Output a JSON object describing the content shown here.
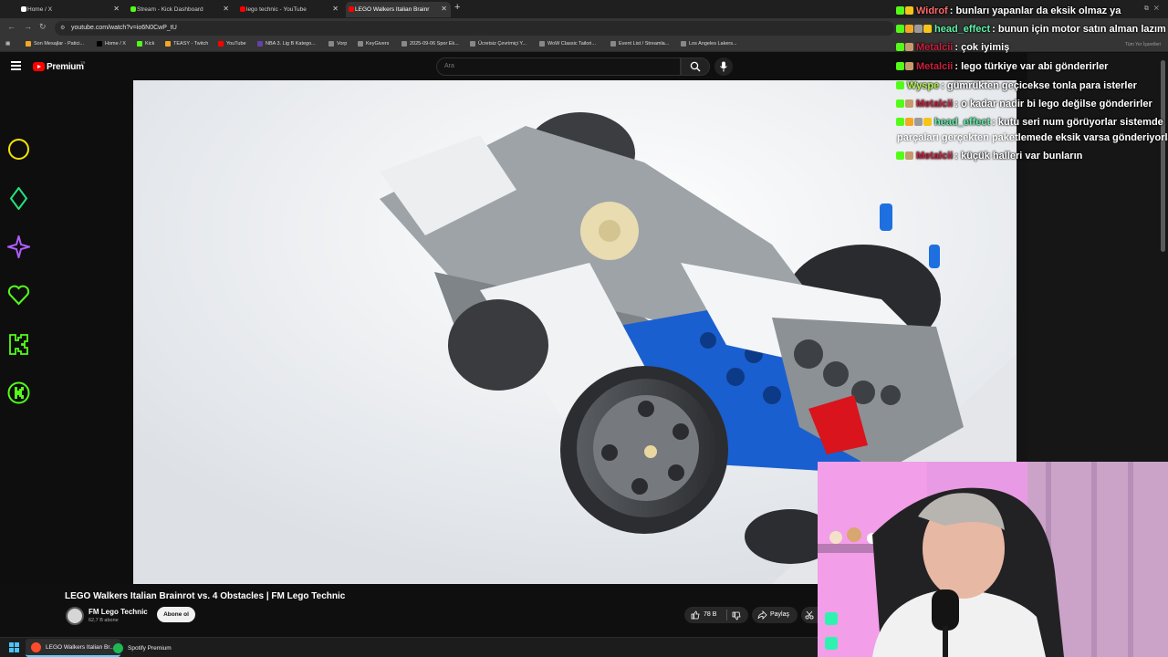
{
  "browser": {
    "tabs": [
      {
        "label": "Home / X",
        "color": "#000000"
      },
      {
        "label": "Stream - Kick Dashboard",
        "color": "#53fc18"
      },
      {
        "label": "lego technic - YouTube",
        "color": "#ff0000"
      },
      {
        "label": "LEGO Walkers Italian Brainr",
        "color": "#ff0000",
        "active": true
      }
    ],
    "url": "youtube.com/watch?v=io6N0CwP_tU",
    "bookmarks": [
      {
        "label": "Son Mesajlar - Patici...",
        "color": "#f5a623"
      },
      {
        "label": "Home / X",
        "color": "#000000"
      },
      {
        "label": "Kick",
        "color": "#53fc18"
      },
      {
        "label": "TEASY - Twitch",
        "color": "#f5a623"
      },
      {
        "label": "YouTube",
        "color": "#ff0000"
      },
      {
        "label": "NBA 3. Lig B Katego...",
        "color": "#6441a5"
      },
      {
        "label": "Vorp",
        "color": "#888888"
      },
      {
        "label": "KeyGivers",
        "color": "#888888"
      },
      {
        "label": "2025-09-06 Spor Ek...",
        "color": "#888888"
      },
      {
        "label": "Ücretsiz Çevrimiçi Y...",
        "color": "#888888"
      },
      {
        "label": "WoW Classic Tailori...",
        "color": "#888888"
      },
      {
        "label": "Event List / Streamla...",
        "color": "#888888"
      },
      {
        "label": "Los Angeles Lakers...",
        "color": "#888888"
      }
    ],
    "all_bookmarks": "Tüm Yer İşaretleri"
  },
  "youtube": {
    "brand": "Premium",
    "region": "TR",
    "search_placeholder": "Ara"
  },
  "chat": {
    "messages": [
      {
        "user": "Widrof",
        "user_color": "#ff6a6a",
        "text": ": bunları yapanlar da eksik olmaz ya",
        "badges": [
          "#53fc18",
          "#f5c518"
        ]
      },
      {
        "user": "head_effect",
        "user_color": "#5ff2a6",
        "text": ": bunun için motor satın alman lazım",
        "badges": [
          "#53fc18",
          "#f5a623",
          "#9b9b9b",
          "#f5c518"
        ]
      },
      {
        "user": "Metalcii",
        "user_color": "#c8203c",
        "text": ": çok iyimiş",
        "badges": [
          "#53fc18",
          "#c59b6d"
        ]
      },
      {
        "user": "Metalcii",
        "user_color": "#c8203c",
        "text": ": lego türkiye var abi gönderirler",
        "badges": [
          "#53fc18",
          "#c59b6d"
        ]
      },
      {
        "user": "Wyspe",
        "user_color": "#b3f24f",
        "text": ": gümrükten geçicekse tonla para isterler",
        "badges": [
          "#53fc18"
        ]
      },
      {
        "user": "Metalcii",
        "user_color": "#c8203c",
        "text": ": o kadar nadir bi lego değilse gönderirler",
        "badges": [
          "#53fc18",
          "#c59b6d"
        ]
      },
      {
        "user": "head_effect",
        "user_color": "#5ff2a6",
        "text": ": kutu seri num görüyorlar sistemde",
        "badges": [
          "#53fc18",
          "#f5a623",
          "#9b9b9b",
          "#f5c518"
        ]
      },
      {
        "user": "Metalcii",
        "user_color": "#c8203c",
        "text": ": küçük halleri var bunların",
        "badges": [
          "#53fc18",
          "#c59b6d"
        ]
      }
    ],
    "continuation": "parçaları gerçekten paketlemede eksik varsa gönderiyorlar"
  },
  "video": {
    "title": "LEGO Walkers Italian Brainrot vs. 4 Obstacles | FM Lego Technic",
    "channel": "FM Lego Technic",
    "subscribers": "62,7 B abone",
    "subscribe_label": "Abone ol",
    "likes": "78 B",
    "share_label": "Paylaş"
  },
  "taskbar": {
    "apps": [
      {
        "label": "LEGO Walkers Italian Br...",
        "color": "#ff4b2b"
      },
      {
        "label": "Spotify Premium",
        "color": "#1db954"
      }
    ]
  },
  "neon_icons": [
    "circle-icon",
    "diamond-icon",
    "star-icon",
    "heart-icon",
    "kick-k-icon",
    "kick-coin-icon"
  ],
  "accent": {
    "kick_green": "#53fc18",
    "youtube_red": "#ff0000"
  }
}
